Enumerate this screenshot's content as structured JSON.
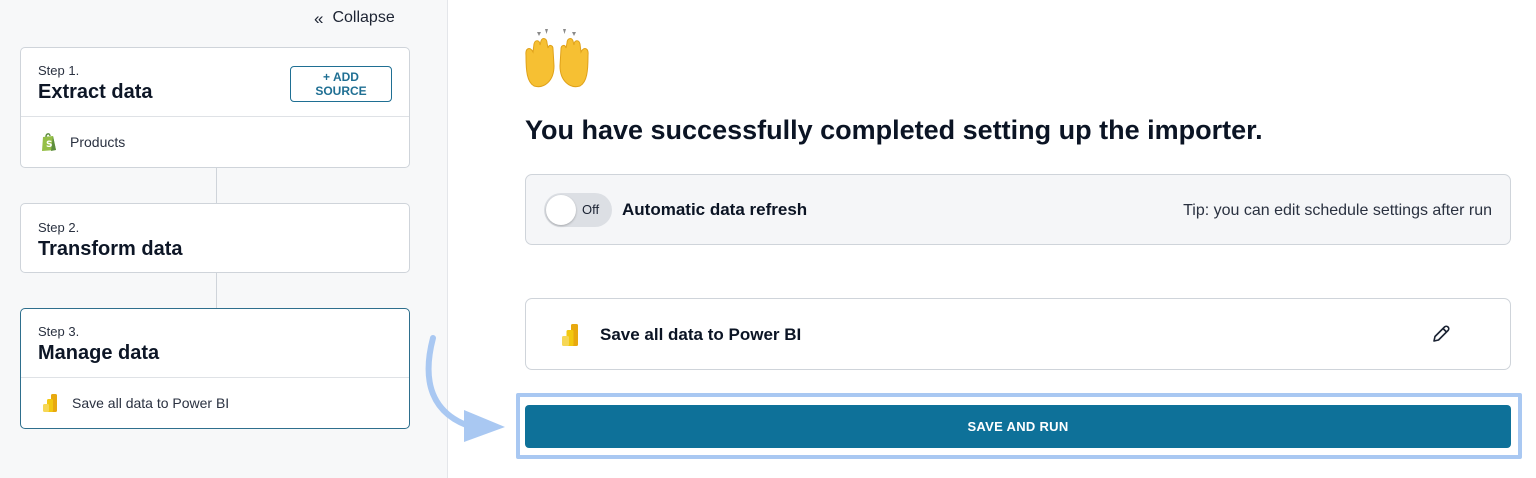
{
  "sidebar": {
    "collapse_icon": "«",
    "collapse_label": "Collapse",
    "steps": [
      {
        "step": "Step 1.",
        "title": "Extract data",
        "action_label": "+ ADD SOURCE",
        "item_icon": "shopify-icon",
        "item_label": "Products"
      },
      {
        "step": "Step 2.",
        "title": "Transform data"
      },
      {
        "step": "Step 3.",
        "title": "Manage data",
        "item_icon": "power-bi-icon",
        "item_label": "Save all data to Power BI"
      }
    ]
  },
  "main": {
    "emoji_icon": "raising-hands-icon",
    "headline": "You have successfully completed setting up the importer.",
    "refresh": {
      "toggle_state": "Off",
      "label": "Automatic data refresh",
      "tip": "Tip: you can edit schedule settings after run"
    },
    "destination": {
      "icon": "power-bi-icon",
      "label": "Save all data to Power BI",
      "edit_icon": "pencil-icon"
    },
    "primary_button": "SAVE AND RUN"
  },
  "colors": {
    "accent": "#0e7199",
    "highlight": "#a9c8f2",
    "power_bi_yellow": "#f2c811"
  }
}
